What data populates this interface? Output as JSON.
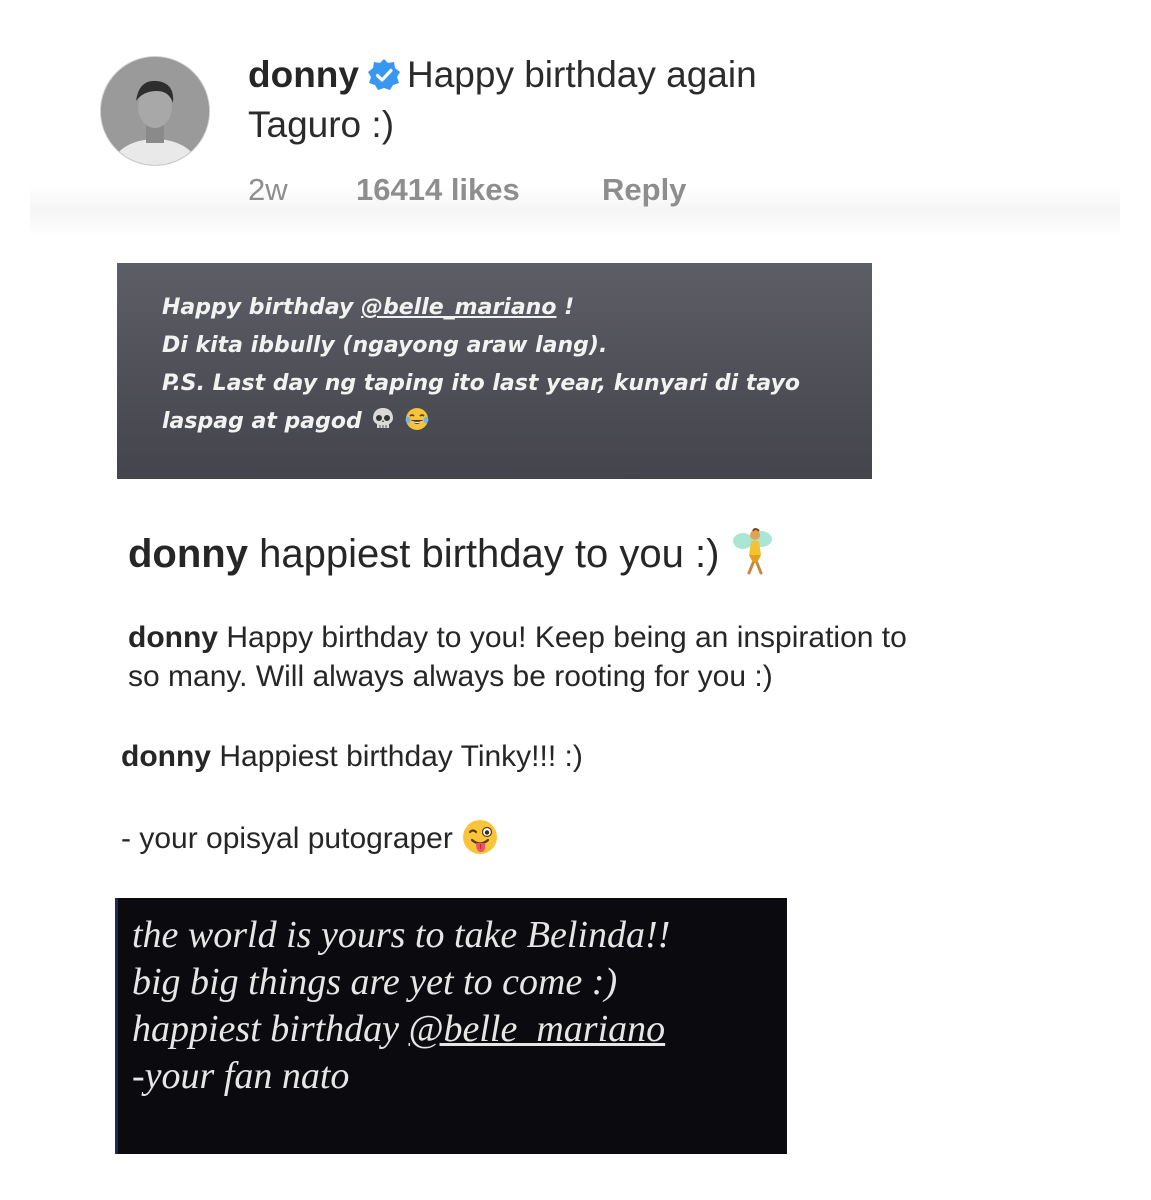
{
  "comment1": {
    "username": "donny",
    "text_line1": "Happy birthday again",
    "text_line2": "Taguro :)",
    "age": "2w",
    "likes": "16414 likes",
    "reply_label": "Reply"
  },
  "story1": {
    "line1_prefix": "Happy birthday ",
    "line1_mention": "@belle_mariano",
    "line1_suffix": " !",
    "line2": "Di kita ibbully (ngayong araw lang).",
    "line3": "P.S. Last day ng taping ito last year, kunyari di tayo",
    "line4": "laspag at pagod"
  },
  "comment2": {
    "username": "donny",
    "text": "happiest birthday to you :)"
  },
  "comment3": {
    "username": "donny",
    "text_line1": "Happy birthday to you! Keep being an inspiration to",
    "text_line2": "so many. Will always always be rooting for you :)"
  },
  "comment4": {
    "username": "donny",
    "text": "Happiest birthday Tinky!!! :)",
    "signature": "- your opisyal putograper"
  },
  "story2": {
    "line1": "the world is yours to take Belinda!!",
    "line2": "big big things are yet to come :)",
    "line3_prefix": "happiest birthday ",
    "line3_mention": "@belle_mariano",
    "line4": "-your fan nato"
  },
  "icons": {
    "verified": "verified-badge-icon",
    "skull": "skull-emoji-icon",
    "laugh": "tears-of-joy-emoji-icon",
    "fairy": "fairy-emoji-icon",
    "wink": "winking-tongue-emoji-icon"
  },
  "colors": {
    "verified_blue": "#3897f0",
    "meta_gray": "#8e8e8e",
    "story1_bg": "#53545c",
    "story2_bg": "#0b0b0f"
  }
}
